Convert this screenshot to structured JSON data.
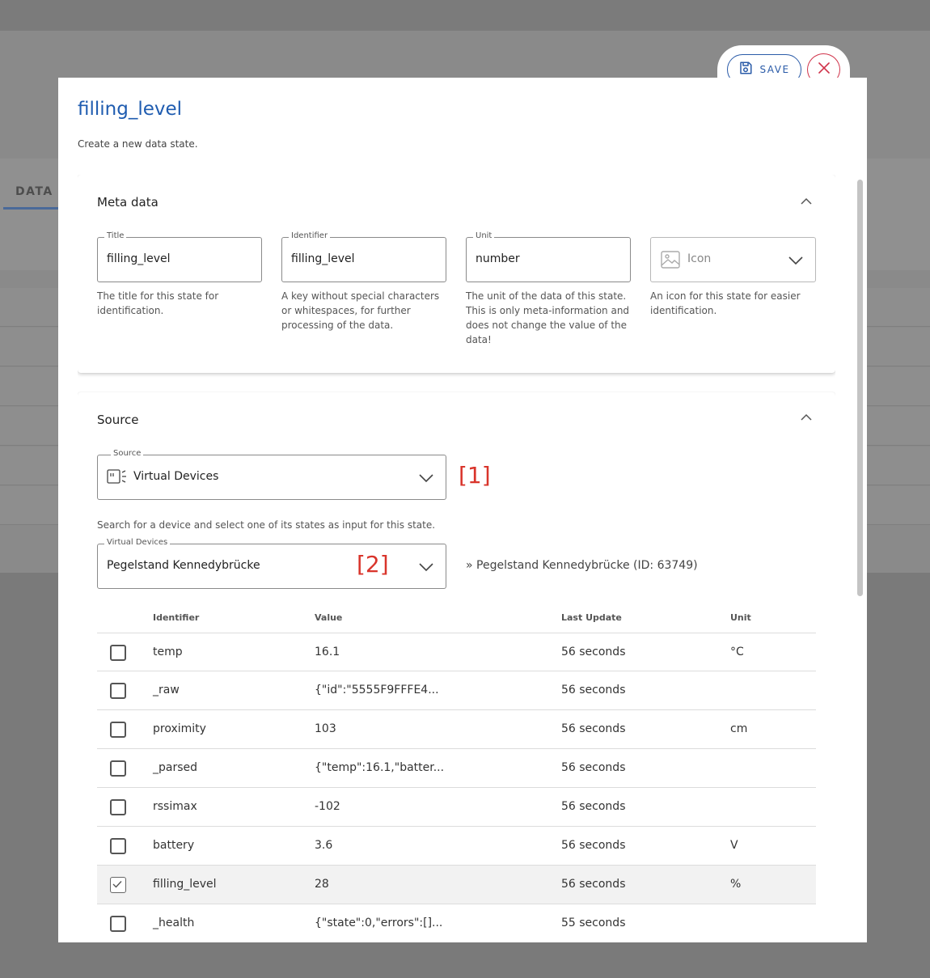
{
  "background": {
    "tab_label": "DATA S"
  },
  "dialog": {
    "title": "filling_level",
    "subtitle": "Create a new data state.",
    "save_label": "SAVE"
  },
  "meta": {
    "title": "Meta data",
    "fields": {
      "title": {
        "label": "Title",
        "value": "filling_level",
        "help": "The title for this state for identification."
      },
      "identifier": {
        "label": "Identifier",
        "value": "filling_level",
        "help": "A key without special characters or whitespaces, for further processing of the data."
      },
      "unit": {
        "label": "Unit",
        "value": "number",
        "help": "The unit of the data of this state. This is only meta-information and does not change the value of the data!"
      },
      "icon": {
        "placeholder": "Icon",
        "help": "An icon for this state for easier identification."
      }
    }
  },
  "source": {
    "title": "Source",
    "source_label": "Source",
    "source_value": "Virtual Devices",
    "annotation_1": "[1]",
    "search_help": "Search for a device and select one of its states as input for this state.",
    "device_label": "Virtual Devices",
    "device_value": "Pegelstand Kennedybrücke",
    "annotation_2": "[2]",
    "device_reference": "» Pegelstand Kennedybrücke (ID: 63749)",
    "table": {
      "headers": {
        "identifier": "Identifier",
        "value": "Value",
        "last_update": "Last Update",
        "unit": "Unit"
      },
      "rows": [
        {
          "identifier": "temp",
          "value": "16.1",
          "last_update": "56 seconds",
          "unit": "°C",
          "checked": false
        },
        {
          "identifier": "_raw",
          "value": "{\"id\":\"5555F9FFFE4...",
          "last_update": "56 seconds",
          "unit": "",
          "checked": false
        },
        {
          "identifier": "proximity",
          "value": "103",
          "last_update": "56 seconds",
          "unit": "cm",
          "checked": false
        },
        {
          "identifier": "_parsed",
          "value": "{\"temp\":16.1,\"batter...",
          "last_update": "56 seconds",
          "unit": "",
          "checked": false
        },
        {
          "identifier": "rssimax",
          "value": "-102",
          "last_update": "56 seconds",
          "unit": "",
          "checked": false
        },
        {
          "identifier": "battery",
          "value": "3.6",
          "last_update": "56 seconds",
          "unit": "V",
          "checked": false
        },
        {
          "identifier": "filling_level",
          "value": "28",
          "last_update": "56 seconds",
          "unit": "%",
          "checked": true
        },
        {
          "identifier": "_health",
          "value": "{\"state\":0,\"errors\":[]...",
          "last_update": "55 seconds",
          "unit": "",
          "checked": false
        }
      ]
    }
  },
  "colors": {
    "accent": "#1f5cb0",
    "danger": "#d0334a",
    "annotation": "#d9342b"
  },
  "icons": {
    "save": "floppy-disk-icon",
    "close": "close-icon",
    "collapse": "chevron-up-icon",
    "dropdown": "chevron-down-icon",
    "image": "image-icon",
    "source": "virtual-device-icon"
  }
}
